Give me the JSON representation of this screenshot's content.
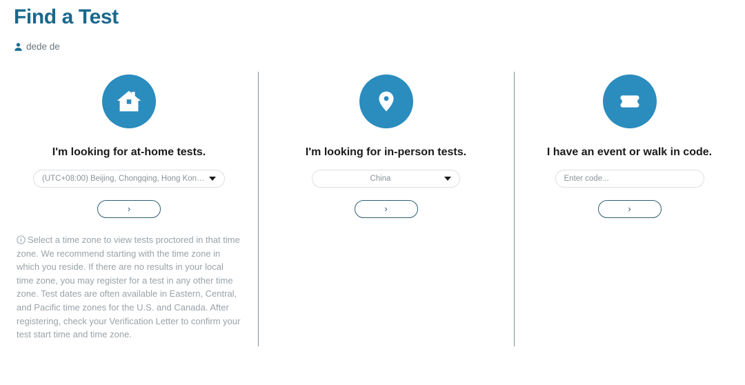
{
  "header": {
    "title": "Find a Test",
    "user_icon": "person-icon",
    "user_name": "dede de"
  },
  "theme": {
    "title_color": "#19688c",
    "icon_circle_color": "#2b8cbe",
    "button_border_color": "#2b5d73",
    "divider_color": "#7d929c",
    "helper_text_color": "#9aa2a8"
  },
  "columns": [
    {
      "icon": "house-icon",
      "heading": "I'm looking for at-home tests.",
      "field_type": "select",
      "field_value": "(UTC+08:00) Beijing, Chongqing, Hong Kong, U...",
      "field_align": "left",
      "caret": "chevron-down-icon",
      "submit_label": "›",
      "helper_icon": "info-icon",
      "helper_text": "Select a time zone to view tests proctored in that time zone. We recommend starting with the time zone in which you reside. If there are no results in your local time zone, you may register for a test in any other time zone. Test dates are often available in Eastern, Central, and Pacific time zones for the U.S. and Canada. After registering, check your Verification Letter to confirm your test start time and time zone."
    },
    {
      "icon": "map-pin-icon",
      "heading": "I'm looking for in-person tests.",
      "field_type": "select",
      "field_value": "China",
      "field_align": "center",
      "caret": "chevron-down-icon",
      "submit_label": "›"
    },
    {
      "icon": "ticket-icon",
      "heading": "I have an event or walk in code.",
      "field_type": "text",
      "field_placeholder": "Enter code...",
      "field_value": "",
      "field_align": "left",
      "submit_label": "›"
    }
  ]
}
